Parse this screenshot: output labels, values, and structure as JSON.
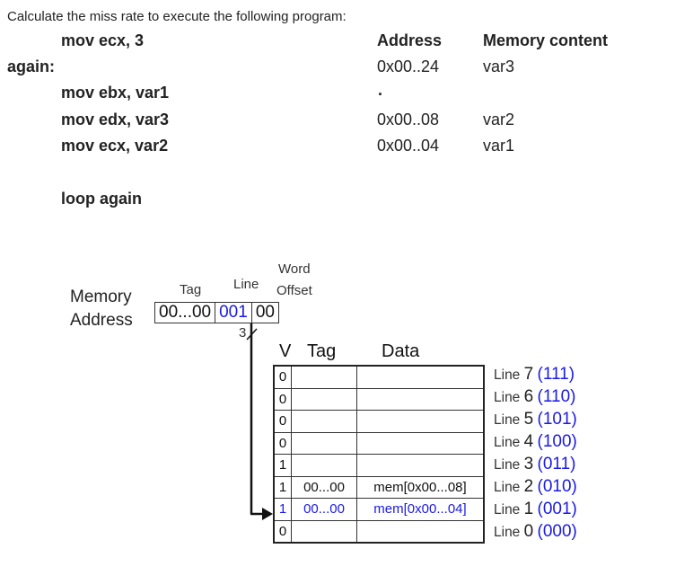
{
  "question": "Calculate the miss rate to execute the following program:",
  "program": {
    "lines": [
      {
        "label": "",
        "code": "mov  ecx, 3"
      },
      {
        "label": "again:",
        "code": ""
      },
      {
        "label": "",
        "code": "mov  ebx, var1"
      },
      {
        "label": "",
        "code": "mov  edx, var3"
      },
      {
        "label": "",
        "code": "mov  ecx, var2"
      },
      {
        "label": "",
        "code": "loop  again"
      }
    ]
  },
  "memory_table": {
    "headers": [
      "Address",
      "Memory content"
    ],
    "rows": [
      {
        "address": "0x00..24",
        "content": "var3"
      },
      {
        "address": ".",
        "content": ""
      },
      {
        "address": "0x00..08",
        "content": "var2"
      },
      {
        "address": "0x00..04",
        "content": "var1"
      }
    ]
  },
  "memory_address": {
    "label_line1": "Memory",
    "label_line2": "Address",
    "field_labels": {
      "tag": "Tag",
      "line": "Line",
      "word_offset_1": "Word",
      "word_offset_2": "Offset"
    },
    "fields": {
      "tag": "00...00",
      "line": "001",
      "word_offset": "00"
    },
    "bus_width": "3"
  },
  "cache": {
    "headers": {
      "v": "V",
      "tag": "Tag",
      "data": "Data"
    },
    "rows": [
      {
        "v": "0",
        "tag": "",
        "data": "",
        "line_label": "Line",
        "line_num": "7",
        "line_bin": "(111)",
        "highlight": false
      },
      {
        "v": "0",
        "tag": "",
        "data": "",
        "line_label": "Line",
        "line_num": "6",
        "line_bin": "(110)",
        "highlight": false
      },
      {
        "v": "0",
        "tag": "",
        "data": "",
        "line_label": "Line",
        "line_num": "5",
        "line_bin": "(101)",
        "highlight": false
      },
      {
        "v": "0",
        "tag": "",
        "data": "",
        "line_label": "Line",
        "line_num": "4",
        "line_bin": "(100)",
        "highlight": false
      },
      {
        "v": "1",
        "tag": "",
        "data": "",
        "line_label": "Line",
        "line_num": "3",
        "line_bin": "(011)",
        "highlight": false
      },
      {
        "v": "1",
        "tag": "00...00",
        "data": "mem[0x00...08]",
        "line_label": "Line",
        "line_num": "2",
        "line_bin": "(010)",
        "highlight": false
      },
      {
        "v": "1",
        "tag": "00...00",
        "data": "mem[0x00...04]",
        "line_label": "Line",
        "line_num": "1",
        "line_bin": "(001)",
        "highlight": true
      },
      {
        "v": "0",
        "tag": "",
        "data": "",
        "line_label": "Line",
        "line_num": "0",
        "line_bin": "(000)",
        "highlight": false
      }
    ]
  },
  "colors": {
    "highlight": "#1a1ae6",
    "text": "#222222"
  }
}
